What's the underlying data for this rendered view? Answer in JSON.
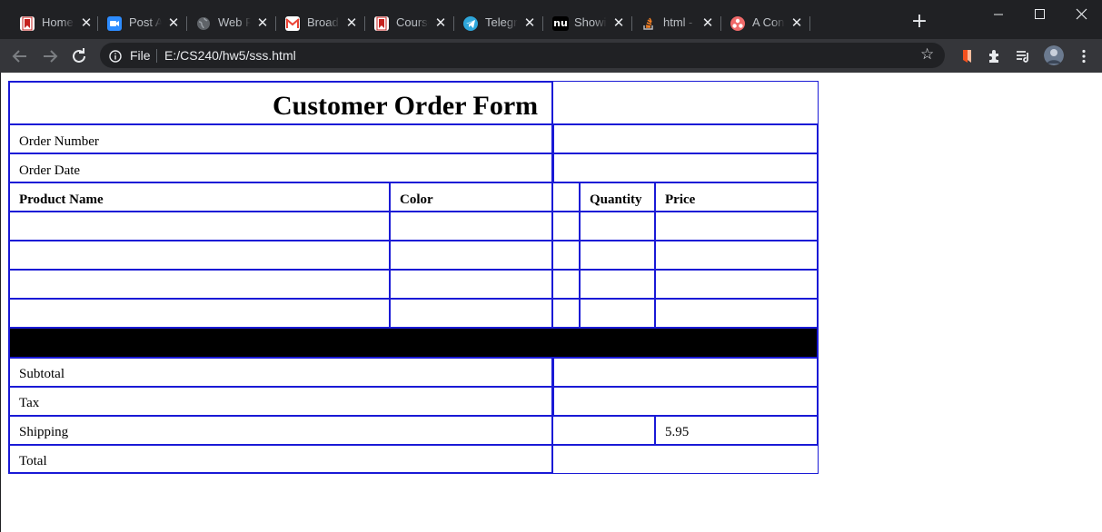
{
  "browser": {
    "tabs": [
      {
        "title": "Home",
        "icon": "bookmark-icon",
        "color": "#c5221f"
      },
      {
        "title": "Post A",
        "icon": "zoom-icon",
        "color": "#2d8cff"
      },
      {
        "title": "Web P",
        "icon": "globe-icon",
        "color": "#9aa0a6"
      },
      {
        "title": "Broad",
        "icon": "gmail-icon",
        "color": "#ea4335"
      },
      {
        "title": "Course",
        "icon": "bookmark-icon",
        "color": "#c5221f"
      },
      {
        "title": "Telegr",
        "icon": "telegram-icon",
        "color": "#2ea6da"
      },
      {
        "title": "Showi",
        "icon": "nu-icon",
        "color": "#000000"
      },
      {
        "title": "html -",
        "icon": "stackoverflow-icon",
        "color": "#f48024"
      },
      {
        "title": "A Con",
        "icon": "asana-icon",
        "color": "#f06a6a"
      }
    ],
    "nu_text": "nu",
    "close_glyph": "✕",
    "new_tab_glyph": "+",
    "address": {
      "scheme_label": "File",
      "url": "E:/CS240/hw5/sss.html"
    },
    "theme": {
      "tabbar": "#202124",
      "toolbar": "#35363a",
      "omnibox": "#202124"
    }
  },
  "form": {
    "title": "Customer Order Form",
    "rows": {
      "order_number": "Order Number",
      "order_date": "Order Date"
    },
    "columns": [
      "Product Name",
      "Color",
      "Quantity",
      "Price"
    ],
    "summary": {
      "subtotal": "Subtotal",
      "tax": "Tax",
      "shipping": "Shipping",
      "shipping_value": "5.95",
      "total": "Total"
    },
    "border_color": "#1a1ad6"
  }
}
